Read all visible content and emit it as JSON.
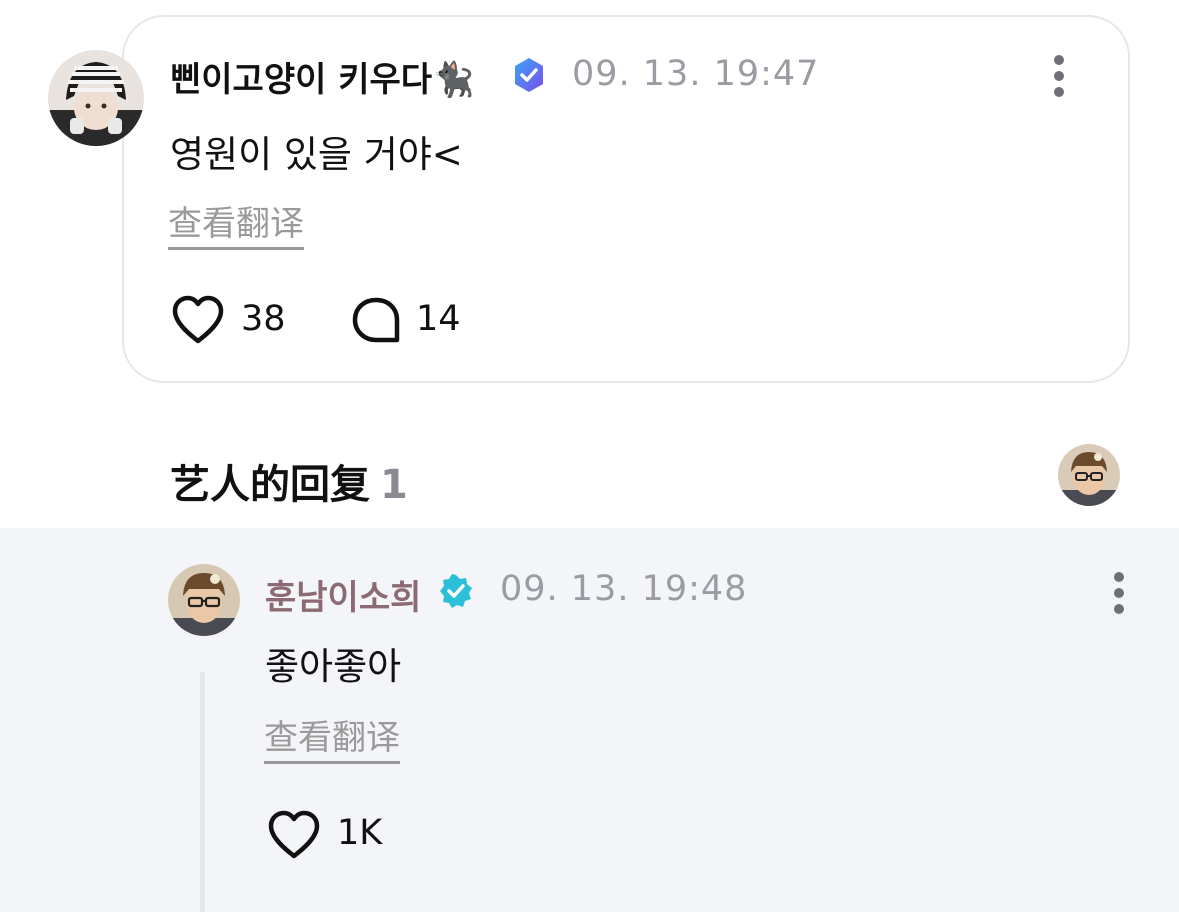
{
  "post": {
    "author_name": "삔이고양이 키우다",
    "author_emoji": "🐈‍⬛",
    "verified_badge_color": "#5b6cf0",
    "timestamp": "09. 13. 19:47",
    "text": "영원이 있을 거야<",
    "translate_label": "查看翻译",
    "like_count": "38",
    "comment_count": "14",
    "icons": {
      "like": "heart-outline-icon",
      "comment": "speech-bubble-icon",
      "more": "vertical-ellipsis-icon",
      "verified": "verified-badge-icon"
    }
  },
  "artist_replies": {
    "title": "艺人的回复",
    "count": "1"
  },
  "reply": {
    "author_name": "훈남이소희",
    "author_name_color": "#8b6a73",
    "verified_badge_color": "#2bbfd8",
    "timestamp": "09. 13. 19:48",
    "text": "좋아좋아",
    "translate_label": "查看翻译",
    "like_count": "1K"
  }
}
